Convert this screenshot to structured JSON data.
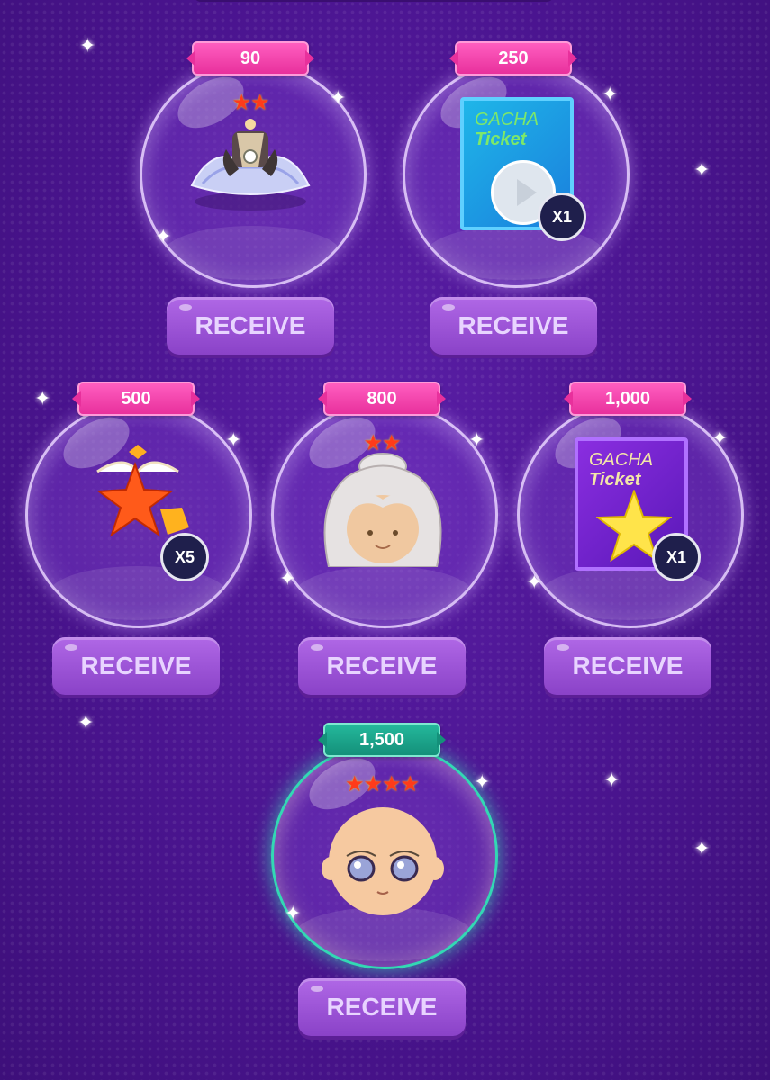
{
  "rewards": [
    {
      "price": "90",
      "stars": "★★",
      "item": "dress-icon",
      "receive_label": "RECEIVE"
    },
    {
      "price": "250",
      "ticket_line1": "GACHA",
      "ticket_line2": "Ticket",
      "qty": "X1",
      "item": "gacha-ticket-blue-icon",
      "receive_label": "RECEIVE"
    },
    {
      "price": "500",
      "qty": "X5",
      "item": "star-potion-icon",
      "receive_label": "RECEIVE"
    },
    {
      "price": "800",
      "stars": "★★",
      "item": "hairstyle-icon",
      "receive_label": "RECEIVE"
    },
    {
      "price": "1,000",
      "ticket_line1": "GACHA",
      "ticket_line2": "Ticket",
      "qty": "X1",
      "item": "gacha-ticket-purple-icon",
      "receive_label": "RECEIVE"
    },
    {
      "price": "1,500",
      "stars": "★★★★",
      "item": "face-icon",
      "receive_label": "RECEIVE"
    }
  ],
  "colors": {
    "tag_pink": "#e8309c",
    "tag_teal": "#14907a",
    "button": "#9a52d6",
    "background": "#4a148f"
  }
}
